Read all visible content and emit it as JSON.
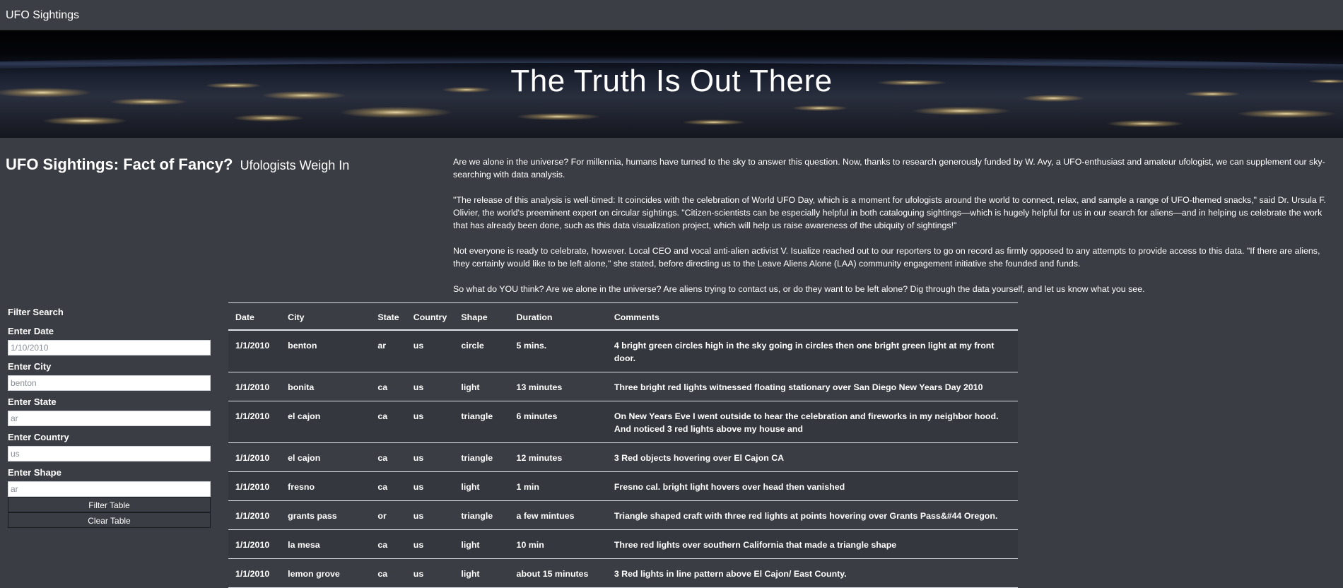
{
  "navbar": {
    "brand": "UFO Sightings"
  },
  "hero": {
    "title": "The Truth Is Out There"
  },
  "headline": {
    "main": "UFO Sightings: Fact of Fancy?",
    "sub": "Ufologists Weigh In"
  },
  "article": {
    "paragraphs": [
      "Are we alone in the universe? For millennia, humans have turned to the sky to answer this question. Now, thanks to research generously funded by W. Avy, a UFO-enthusiast and amateur ufologist, we can supplement our sky-searching with data analysis.",
      "\"The release of this analysis is well-timed: It coincides with the celebration of World UFO Day, which is a moment for ufologists around the world to connect, relax, and sample a range of UFO-themed snacks,\" said Dr. Ursula F. Olivier, the world's preeminent expert on circular sightings. \"Citizen-scientists can be especially helpful in both cataloguing sightings—which is hugely helpful for us in our search for aliens—and in helping us celebrate the work that has already been done, such as this data visualization project, which will help us raise awareness of the ubiquity of sightings!\"",
      "Not everyone is ready to celebrate, however. Local CEO and vocal anti-alien activist V. Isualize reached out to our reporters to go on record as firmly opposed to any attempts to provide access to this data. \"If there are aliens, they certainly would like to be left alone,\" she stated, before directing us to the Leave Aliens Alone (LAA) community engagement initiative she founded and funds.",
      "So what do YOU think? Are we alone in the universe? Are aliens trying to contact us, or do they want to be left alone? Dig through the data yourself, and let us know what you see."
    ]
  },
  "filters": {
    "title": "Filter Search",
    "date": {
      "label": "Enter Date",
      "placeholder": "1/10/2010"
    },
    "city": {
      "label": "Enter City",
      "placeholder": "benton"
    },
    "state": {
      "label": "Enter State",
      "placeholder": "ar"
    },
    "country": {
      "label": "Enter Country",
      "placeholder": "us"
    },
    "shape": {
      "label": "Enter Shape",
      "placeholder": "ar"
    },
    "filter_button": "Filter Table",
    "clear_button": "Clear Table"
  },
  "table": {
    "headers": [
      "Date",
      "City",
      "State",
      "Country",
      "Shape",
      "Duration",
      "Comments"
    ],
    "rows": [
      [
        "1/1/2010",
        "benton",
        "ar",
        "us",
        "circle",
        "5 mins.",
        "4 bright green circles high in the sky going in circles then one bright green light at my front door."
      ],
      [
        "1/1/2010",
        "bonita",
        "ca",
        "us",
        "light",
        "13 minutes",
        "Three bright red lights witnessed floating stationary over San Diego New Years Day 2010"
      ],
      [
        "1/1/2010",
        "el cajon",
        "ca",
        "us",
        "triangle",
        "6 minutes",
        "On New Years Eve I went outside to hear the celebration and fireworks in my neighbor hood. And noticed 3 red lights above my house and"
      ],
      [
        "1/1/2010",
        "el cajon",
        "ca",
        "us",
        "triangle",
        "12 minutes",
        "3 Red objects hovering over El Cajon CA"
      ],
      [
        "1/1/2010",
        "fresno",
        "ca",
        "us",
        "light",
        "1 min",
        "Fresno cal. bright light hovers over head then vanished"
      ],
      [
        "1/1/2010",
        "grants pass",
        "or",
        "us",
        "triangle",
        "a few mintues",
        "Triangle shaped craft with three red lights at points hovering over Grants Pass&#44 Oregon."
      ],
      [
        "1/1/2010",
        "la mesa",
        "ca",
        "us",
        "light",
        "10 min",
        "Three red lights over southern California that made a triangle shape"
      ],
      [
        "1/1/2010",
        "lemon grove",
        "ca",
        "us",
        "light",
        "about 15 minutes",
        "3 Red lights in line pattern above El Cajon/ East County."
      ]
    ]
  }
}
